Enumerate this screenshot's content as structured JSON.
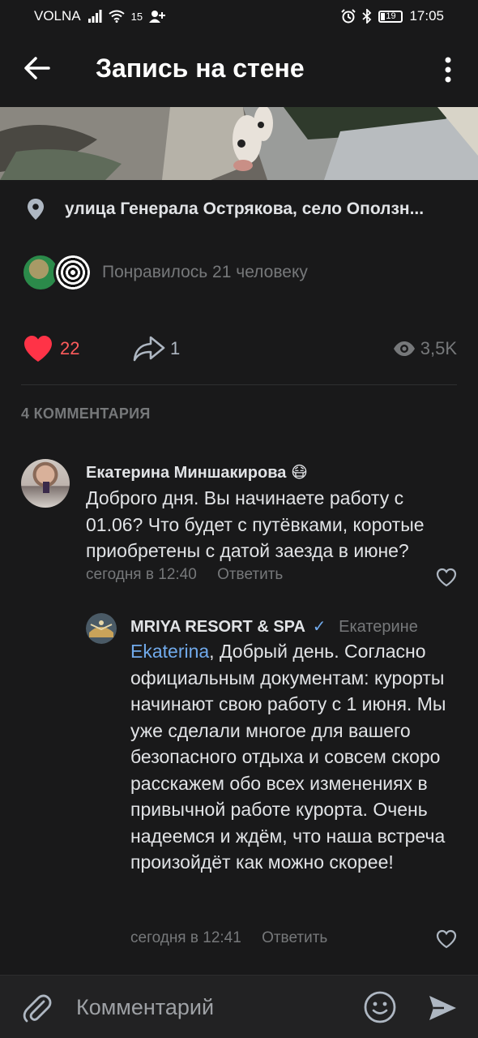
{
  "status_bar": {
    "carrier": "VOLNA",
    "network_speed": "15",
    "battery": "19",
    "time": "17:05"
  },
  "header": {
    "title": "Запись на стене"
  },
  "post": {
    "location": "улица Генерала Острякова, село Оползн...",
    "likers_text": "Понравилось 21 человеку",
    "likes_count": "22",
    "shares_count": "1",
    "views_count": "3,5K"
  },
  "comments_header": "4 КОММЕНТАРИЯ",
  "comments": [
    {
      "author": "Екатерина Миншакирова",
      "author_emoji": "😷",
      "text": "Доброго дня. Вы начинаете работу с 01.06? Что будет с путёвками, коротые приобретены с датой заезда в июне?",
      "time": "сегодня в 12:40",
      "reply_label": "Ответить"
    },
    {
      "author": "MRIYA RESORT & SPA",
      "verified_mark": "✓",
      "reply_to": "Екатерине",
      "mention": "Ekaterina",
      "text": ", Добрый день. Согласно официальным документам: курорты начинают свою работу с 1 июня. Мы уже сделали многое для вашего безопасного отдыха и совсем скоро расскажем обо всех изменениях в привычной работе курорта. Очень надеемся и ждём, что наша встреча произойдёт как можно скорее!",
      "time": "сегодня в 12:41",
      "reply_label": "Ответить"
    }
  ],
  "compose": {
    "placeholder": "Комментарий"
  },
  "colors": {
    "background": "#19191a",
    "accent": "#71aaeb",
    "like": "#ff5c5c",
    "secondary_text": "#76787a"
  }
}
